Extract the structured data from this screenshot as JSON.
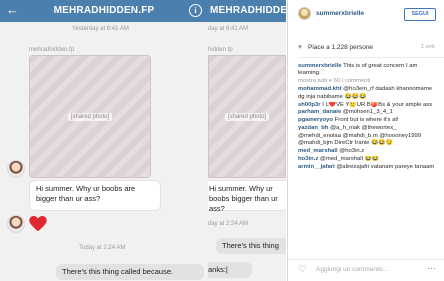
{
  "dm": {
    "title": "MEHRADHIDDEN.FP",
    "title_cropped": "MEHRADHIDDEN.FP",
    "yesterday_ts": "Yesterday at 6:41 AM",
    "yesterday_ts_cropped": "day at 6:41 AM",
    "sender_name": "mehradhidden.fp",
    "sender_name_cropped": "hidden.fp",
    "photo_label": "[shared photo]",
    "incoming_message": "Hi summer. Why ur boobs are bigger than ur ass?",
    "incoming_message_cropped": "Hi summer. Why ur boobs bigger than ur ass?",
    "today_ts": "Today at 2:24 AM",
    "today_ts_cropped": "day at 2:24 AM",
    "outgoing_message": "There's this thing called because.",
    "outgoing_message_cropped_1": "There's this thing",
    "outgoing_message_cropped_2": "anks:|"
  },
  "instagram": {
    "username": "summerxbrielle",
    "follow_label": "SEGUI",
    "likes_text": "Piace a 1,228 persone",
    "time_ago": "1 sett.",
    "comments": [
      {
        "user": "summerxbrielle",
        "text": "This is of great concern I am learning."
      },
      {
        "more": "mostra tutti e 60 i commenti"
      },
      {
        "user": "mohammad.kht",
        "text": "@ho3ein_rf dadash khanoomame dg inja nabibame 😂😂😂"
      },
      {
        "user": "sh00p3r",
        "text": "I L❤️VE Y🙂UR B🍑Bs & your ample ass"
      },
      {
        "user": "parham_danaie",
        "text": "@mohsen1_3_4_1"
      },
      {
        "user": "pgameryoyo",
        "text": "Front but is where it's at!"
      },
      {
        "user": "yazdan_bh",
        "text": "@a_h_niak @thewortex_ @mehdi_enolaa @mahdi_b.m @hoooney1999 @mahdi_bjm DireCtr Iranie 😂😂😏"
      },
      {
        "user": "med_marshall",
        "text": "@ho3in.z"
      },
      {
        "user": "ho3in.z",
        "text": "@med_marshall 😂😂"
      },
      {
        "user": "armin__jafari",
        "text": "@alirezajafri vatanam pareye tanaam"
      }
    ],
    "comment_placeholder": "Aggiungi un commento...",
    "more_icon": "···"
  },
  "colors": {
    "header_blue": "#4a7fae",
    "link_blue": "#2d5b84",
    "heart_red": "#e0262f",
    "follow_blue": "#3f7ab4"
  }
}
